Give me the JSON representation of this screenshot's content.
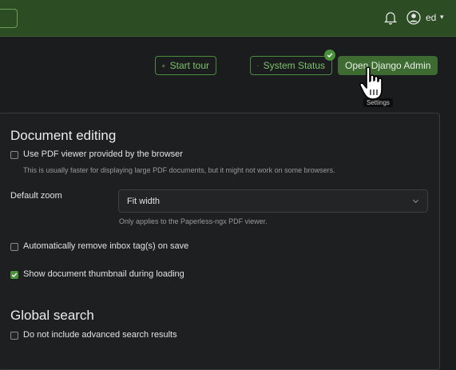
{
  "topbar": {
    "user": {
      "name": "ed"
    },
    "icons": {
      "bell": "bell-icon",
      "avatar": "user-circle-icon",
      "caret": "caret-down-icon"
    }
  },
  "actions": {
    "start_tour": "Start tour",
    "system_status": "System Status",
    "open_admin": "Open Django Admin",
    "tooltip": "Settings"
  },
  "settings": {
    "document_editing": {
      "title": "Document editing",
      "pdf_viewer": {
        "label": "Use PDF viewer provided by the browser",
        "hint": "This is usually faster for displaying large PDF documents, but it might not work on some browsers.",
        "checked": false
      },
      "default_zoom": {
        "label": "Default zoom",
        "value": "Fit width",
        "hint": "Only applies to the Paperless-ngx PDF viewer."
      },
      "remove_inbox_tags": {
        "label": "Automatically remove inbox tag(s) on save",
        "checked": false
      },
      "show_thumbnail": {
        "label": "Show document thumbnail during loading",
        "checked": true
      }
    },
    "global_search": {
      "title": "Global search",
      "no_advanced": {
        "label": "Do not include advanced search results",
        "checked": false
      }
    }
  },
  "colors": {
    "topbar": "#2c4d23",
    "accent": "#4a8f3a",
    "background": "#1b1c1e"
  }
}
